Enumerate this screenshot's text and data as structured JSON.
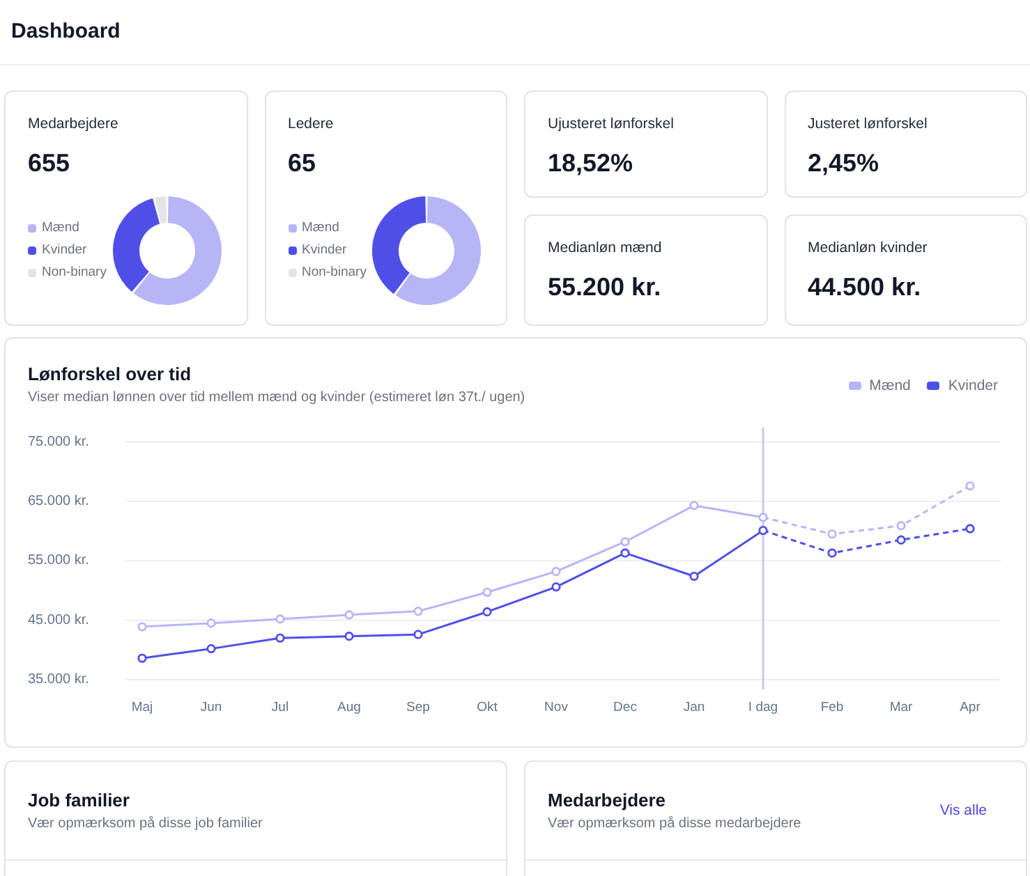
{
  "header": {
    "title": "Dashboard"
  },
  "stat_cards": [
    {
      "kind": "donut",
      "title": "Medarbejdere",
      "value": "655",
      "legend": [
        {
          "label": "Mænd",
          "color": "#b6b6f6"
        },
        {
          "label": "Kvinder",
          "color": "#4f4fe8"
        },
        {
          "label": "Non-binary",
          "color": "#e4e4e7"
        }
      ]
    },
    {
      "kind": "donut",
      "title": "Ledere",
      "value": "65",
      "legend": [
        {
          "label": "Mænd",
          "color": "#b6b6f6"
        },
        {
          "label": "Kvinder",
          "color": "#4f4fe8"
        },
        {
          "label": "Non-binary",
          "color": "#e4e4e7"
        }
      ]
    },
    {
      "kind": "kpi",
      "title": "Ujusteret lønforskel",
      "value": "18,52%"
    },
    {
      "kind": "kpi",
      "title": "Justeret lønforskel",
      "value": "2,45%"
    },
    {
      "kind": "kpi",
      "title": "Medianløn mænd",
      "value": "55.200 kr."
    },
    {
      "kind": "kpi",
      "title": "Medianløn kvinder",
      "value": "44.500 kr."
    }
  ],
  "salary_chart": {
    "title": "Lønforskel over tid",
    "subtitle": "Viser median lønnen over tid mellem mænd og kvinder (estimeret løn 37t./ ugen)",
    "chart_data": {
      "type": "line",
      "categories": [
        "Maj",
        "Jun",
        "Jul",
        "Aug",
        "Sep",
        "Okt",
        "Nov",
        "Dec",
        "Jan",
        "I dag",
        "Feb",
        "Mar",
        "Apr"
      ],
      "series": [
        {
          "name": "Mænd",
          "color": "#b6b6f6",
          "line_style": "dashed",
          "marker": "circle",
          "values": [
            43900,
            44500,
            45200,
            45900,
            46500,
            49700,
            53200,
            58200,
            64300,
            62300,
            59500,
            60900,
            67600
          ]
        },
        {
          "name": "Kvinder",
          "color": "#4f4fe8",
          "line_style": "dashed",
          "marker": "circle",
          "values": [
            38600,
            40200,
            42000,
            42300,
            42600,
            46400,
            50600,
            56300,
            52400,
            60100,
            56300,
            58500,
            60400
          ]
        }
      ],
      "ylim": [
        35000,
        75000
      ],
      "yticks": [
        {
          "value": 35000,
          "label": "35.000 kr."
        },
        {
          "value": 45000,
          "label": "45.000 kr."
        },
        {
          "value": 55000,
          "label": "55.000 kr."
        },
        {
          "value": 65000,
          "label": "65.000 kr."
        },
        {
          "value": 75000,
          "label": "75.000 kr."
        }
      ],
      "grid": "y",
      "ref_lines": [
        {
          "axis": "x",
          "value": "I dag",
          "color": "#c7c7f7"
        }
      ]
    }
  },
  "panels": [
    {
      "title": "Job familier",
      "subtitle": "Vær opmærksom på disse job familier"
    },
    {
      "title": "Medarbejdere",
      "subtitle": "Vær opmærksom på disse medarbejdere",
      "link": "Vis alle"
    }
  ]
}
